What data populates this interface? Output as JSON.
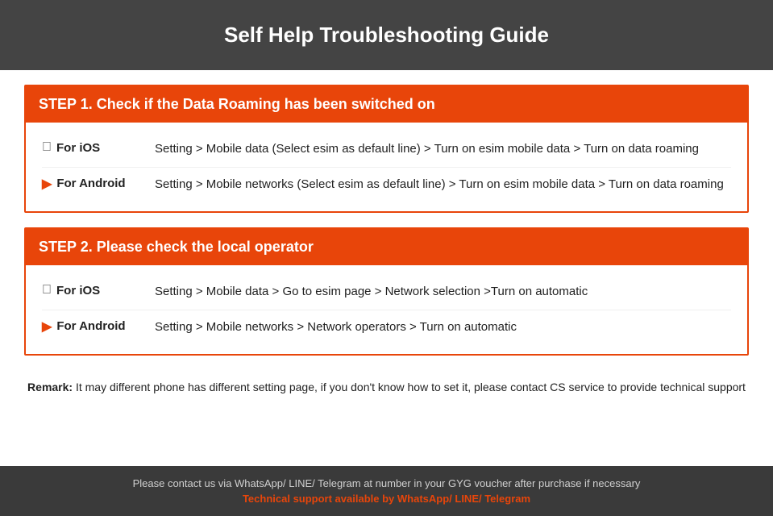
{
  "header": {
    "title": "Self Help Troubleshooting Guide"
  },
  "step1": {
    "header": "STEP 1.  Check if the Data Roaming has been switched on",
    "ios_label": "For iOS",
    "android_label": "For Android",
    "ios_text": "Setting > Mobile data (Select esim as default line) > Turn on esim mobile data > Turn on data roaming",
    "android_text": "Setting > Mobile networks (Select esim as default line) > Turn on esim mobile data > Turn on data roaming"
  },
  "step2": {
    "header": "STEP 2.  Please check the local operator",
    "ios_label": "For iOS",
    "android_label": "For Android",
    "ios_text": "Setting > Mobile data > Go to esim page > Network selection >Turn on automatic",
    "android_text": "Setting > Mobile networks > Network operators > Turn on automatic"
  },
  "remark": {
    "label": "Remark:",
    "text": "It may different phone has different setting page, if you don't know how to set it,  please contact CS service to provide technical support"
  },
  "footer": {
    "main_text": "Please contact us via WhatsApp/ LINE/ Telegram at number in your GYG voucher after purchase if necessary",
    "support_text": "Technical support available by WhatsApp/ LINE/ Telegram"
  }
}
